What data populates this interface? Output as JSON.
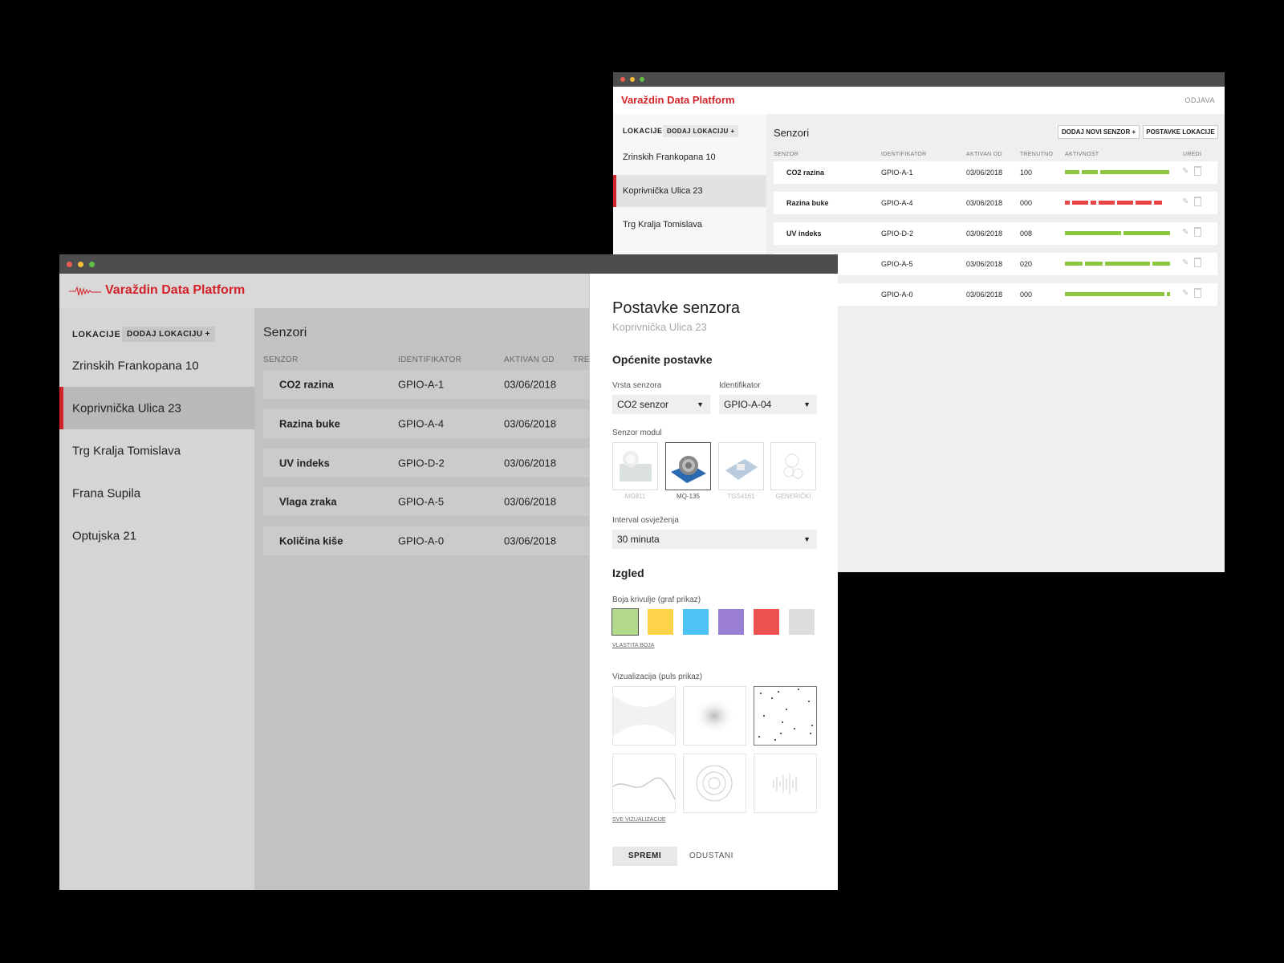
{
  "colors": {
    "brand": "#d2232a",
    "green": "#8cc63f",
    "red": "#e84343"
  },
  "back": {
    "brand": "Varaždin Data Platform",
    "logout": "ODJAVA",
    "sidebar": {
      "title": "LOKACIJE",
      "add": "DODAJ LOKACIJU +",
      "items": [
        "Zrinskih Frankopana 10",
        "Koprivnička Ulica 23",
        "Trg Kralja Tomislava"
      ],
      "selected_index": 1
    },
    "main": {
      "title": "Senzori",
      "add_sensor": "DODAJ NOVI SENZOR +",
      "location_settings": "POSTAVKE LOKACIJE",
      "columns": [
        "SENZOR",
        "IDENTIFIKATOR",
        "AKTIVAN OD",
        "TRENUTNO",
        "AKTIVNOST",
        "UREDI"
      ],
      "rows": [
        {
          "name": "CO2 razina",
          "id": "GPIO-A-1",
          "since": "03/06/2018",
          "current": "100",
          "activity": "green"
        },
        {
          "name": "Razina buke",
          "id": "GPIO-A-4",
          "since": "03/06/2018",
          "current": "000",
          "activity": "red"
        },
        {
          "name": "UV indeks",
          "id": "GPIO-D-2",
          "since": "03/06/2018",
          "current": "008",
          "activity": "green"
        },
        {
          "name": "",
          "id": "GPIO-A-5",
          "since": "03/06/2018",
          "current": "020",
          "activity": "green"
        },
        {
          "name": "",
          "id": "GPIO-A-0",
          "since": "03/06/2018",
          "current": "000",
          "activity": "green"
        }
      ]
    }
  },
  "front": {
    "brand": "Varaždin Data Platform",
    "sidebar": {
      "title": "LOKACIJE",
      "add": "DODAJ LOKACIJU +",
      "items": [
        "Zrinskih Frankopana 10",
        "Koprivnička Ulica 23",
        "Trg Kralja Tomislava",
        "Frana Supila",
        "Optujska 21"
      ],
      "selected_index": 1
    },
    "main": {
      "title": "Senzori",
      "columns": [
        "SENZOR",
        "IDENTIFIKATOR",
        "AKTIVAN OD",
        "TRE"
      ],
      "rows": [
        {
          "name": "CO2 razina",
          "id": "GPIO-A-1",
          "since": "03/06/2018"
        },
        {
          "name": "Razina buke",
          "id": "GPIO-A-4",
          "since": "03/06/2018"
        },
        {
          "name": "UV indeks",
          "id": "GPIO-D-2",
          "since": "03/06/2018"
        },
        {
          "name": "Vlaga zraka",
          "id": "GPIO-A-5",
          "since": "03/06/2018"
        },
        {
          "name": "Količina kiše",
          "id": "GPIO-A-0",
          "since": "03/06/2018"
        }
      ]
    }
  },
  "panel": {
    "title": "Postavke senzora",
    "subtitle": "Koprivnička Ulica 23",
    "general_heading": "Općenite postavke",
    "sensor_type": {
      "label": "Vrsta senzora",
      "value": "CO2 senzor"
    },
    "identifier": {
      "label": "Identifikator",
      "value": "GPIO-A-04"
    },
    "module": {
      "label": "Senzor modul",
      "options": [
        "MG811",
        "MQ-135",
        "TGS4161",
        "GENERIČKI"
      ],
      "selected": "MQ-135"
    },
    "interval": {
      "label": "Interval osvježenja",
      "value": "30 minuta"
    },
    "look_heading": "Izgled",
    "curve_color": {
      "label": "Boja krivulje (graf prikaz)",
      "swatches": [
        "#b3d98b",
        "#fdd34a",
        "#4dc3f5",
        "#9a7ed4",
        "#ee5250",
        "#dddddd"
      ],
      "selected": "#b3d98b",
      "custom": "VLASTITA BOJA"
    },
    "visualization": {
      "label": "Vizualizacija (puls prikaz)",
      "all": "SVE VIZUALIZACIJE"
    },
    "save": "SPREMI",
    "cancel": "ODUSTANI"
  }
}
